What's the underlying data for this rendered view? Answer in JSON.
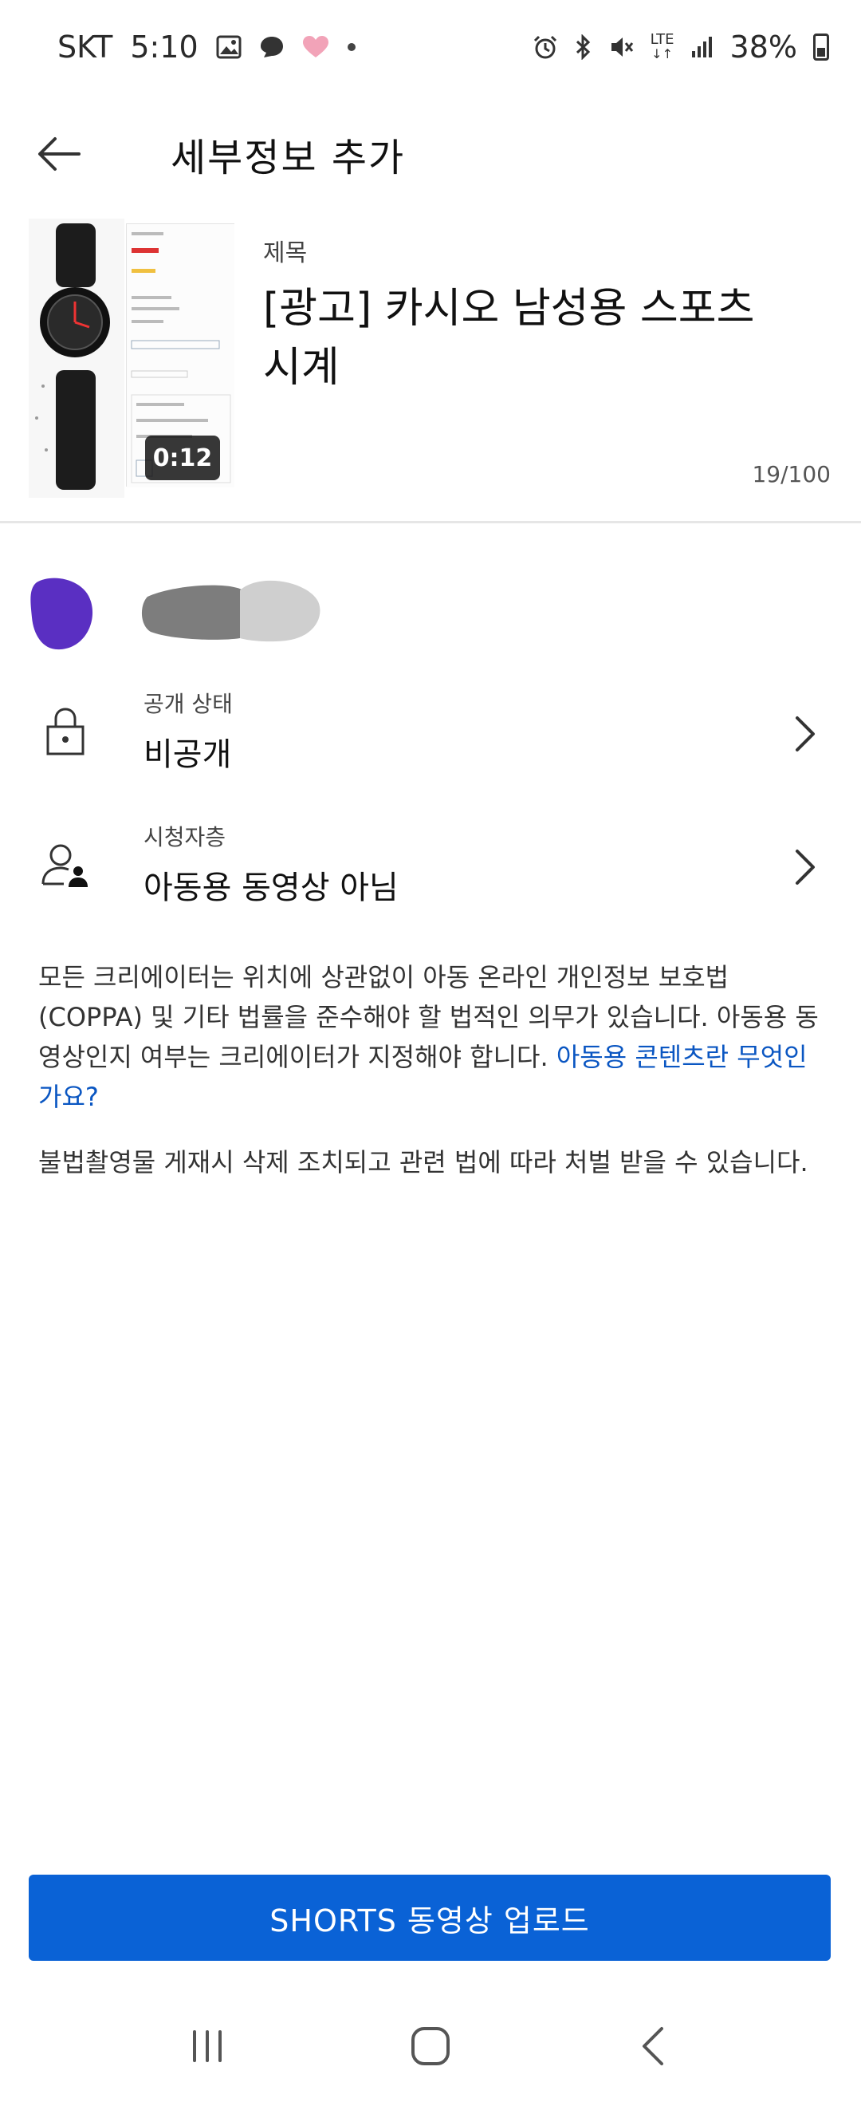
{
  "status_bar": {
    "carrier": "SKT",
    "time": "5:10",
    "network": "LTE",
    "battery": "38%",
    "left_icons": [
      "gallery-icon",
      "chat-icon",
      "heart-icon",
      "dot-icon"
    ],
    "right_icons": [
      "alarm-icon",
      "bluetooth-icon",
      "mute-icon",
      "lte-icon",
      "signal-icon",
      "battery-icon"
    ]
  },
  "app_bar": {
    "title": "세부정보 추가"
  },
  "video": {
    "duration": "0:12",
    "title_label": "제목",
    "title_value": "[광고] 카시오 남성용 스포츠 시계",
    "char_count": "19/100"
  },
  "visibility": {
    "label": "공개 상태",
    "value": "비공개"
  },
  "audience": {
    "label": "시청자층",
    "value": "아동용 동영상 아님"
  },
  "info": {
    "text": "모든 크리에이터는 위치에 상관없이 아동 온라인 개인정보 보호법(COPPA) 및 기타 법률을 준수해야 할 법적인 의무가 있습니다. 아동용 동영상인지 여부는 크리에이터가 지정해야 합니다. ",
    "link": "아동용 콘텐츠란 무엇인가요?"
  },
  "legal_notice": "불법촬영물 게재시 삭제 조치되고 관련 법에 따라 처벌 받을 수 있습니다.",
  "upload_button": "SHORTS 동영상 업로드",
  "colors": {
    "accent": "#0a62d6",
    "link": "#0a56c2",
    "avatar": "#5a2fc2"
  }
}
